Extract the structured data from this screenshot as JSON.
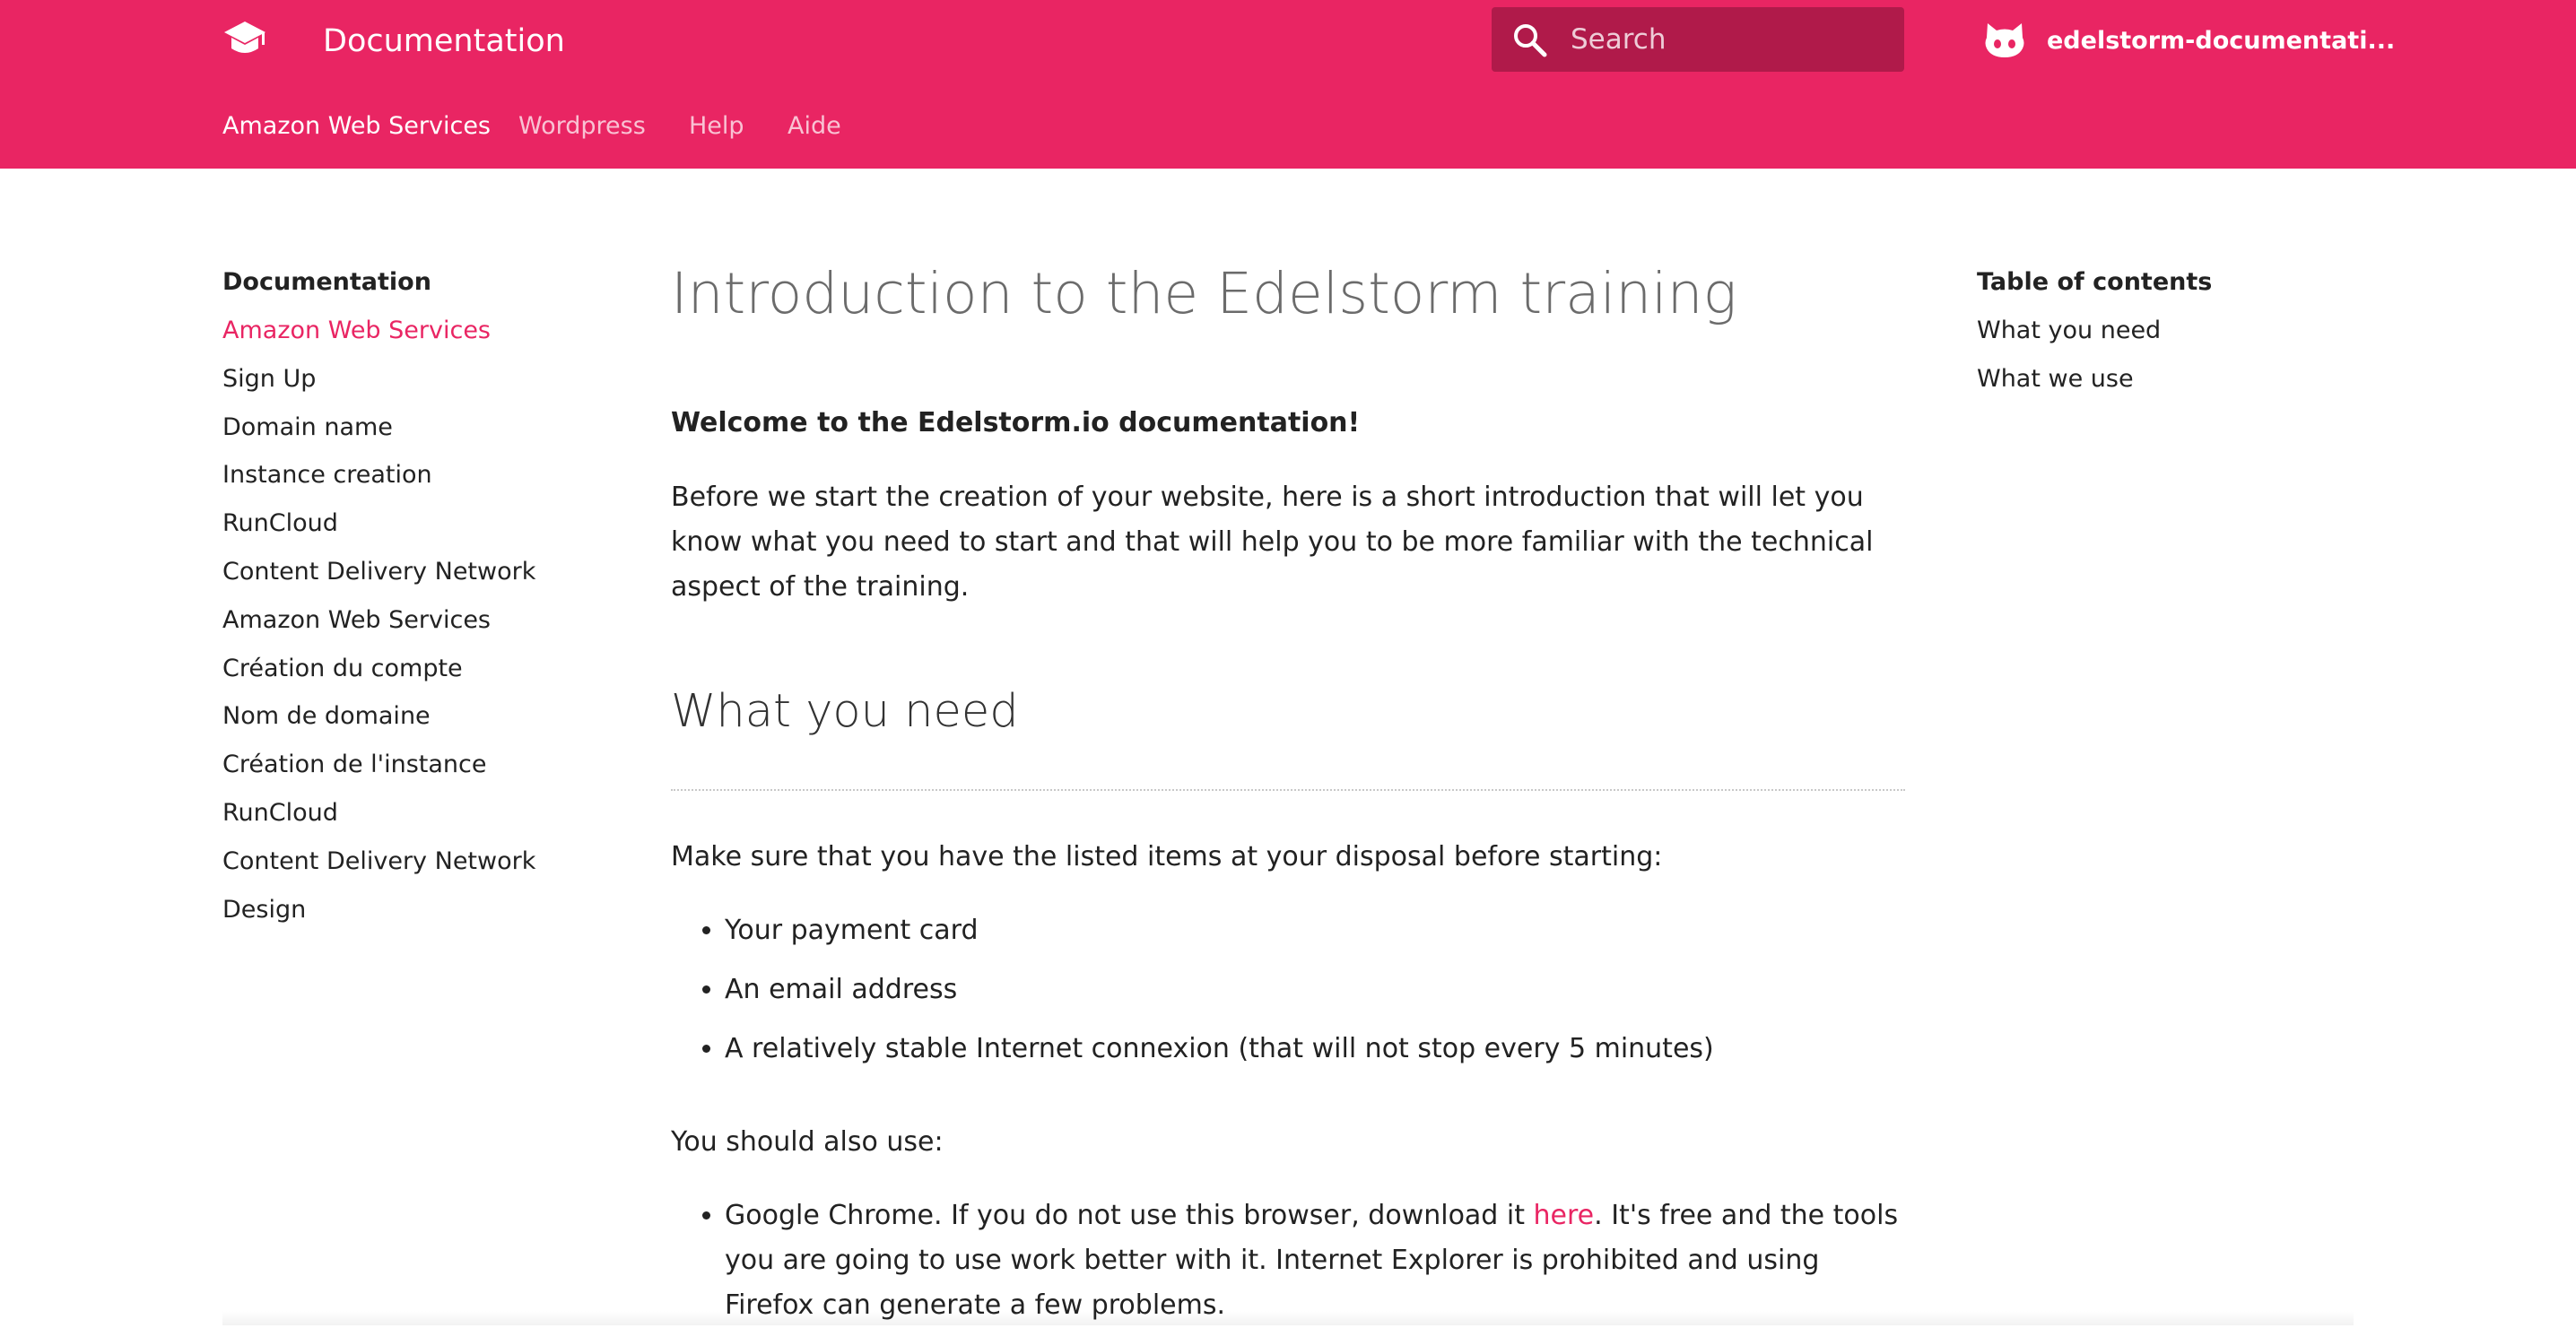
{
  "colors": {
    "brand": "#e92563",
    "search_bg": "#b01a4a",
    "text": "#222222",
    "title": "#6b6b6b"
  },
  "header": {
    "logo_icon": "graduation-cap-icon",
    "title": "Documentation",
    "search": {
      "placeholder": "Search",
      "icon": "magnifier-icon"
    },
    "repo": {
      "icon": "github-cat-icon",
      "name": "edelstorm-documentati..."
    },
    "tabs": [
      {
        "label": "Amazon Web Services",
        "active": true
      },
      {
        "label": "Wordpress",
        "active": false
      },
      {
        "label": "Help",
        "active": false
      },
      {
        "label": "Aide",
        "active": false
      }
    ]
  },
  "sidebar": {
    "title": "Documentation",
    "items": [
      {
        "label": "Amazon Web Services",
        "active": true
      },
      {
        "label": "Sign Up"
      },
      {
        "label": "Domain name"
      },
      {
        "label": "Instance creation"
      },
      {
        "label": "RunCloud"
      },
      {
        "label": "Content Delivery Network"
      },
      {
        "label": "Amazon Web Services"
      },
      {
        "label": "Création du compte"
      },
      {
        "label": "Nom de domaine"
      },
      {
        "label": "Création de l'instance"
      },
      {
        "label": "RunCloud"
      },
      {
        "label": "Content Delivery Network"
      },
      {
        "label": "Design"
      }
    ]
  },
  "main": {
    "title": "Introduction to the Edelstorm training",
    "welcome": "Welcome to the Edelstorm.io documentation!",
    "intro": "Before we start the creation of your website, here is a short introduction that will let you know what you need to start and that will help you to be more familiar with the technical aspect of the training.",
    "section_heading": "What you need",
    "need_intro": "Make sure that you have the listed items at your disposal before starting:",
    "needs": [
      "Your payment card",
      "An email address",
      "A relatively stable Internet connexion (that will not stop every 5 minutes)"
    ],
    "also_use": "You should also use:",
    "chrome": {
      "before": "Google Chrome. If you do not use this browser, download it ",
      "link": "here",
      "after": ". It's free and the tools you are going to use work better with it. Internet Explorer is prohibited and using Firefox can generate a few problems."
    }
  },
  "toc": {
    "title": "Table of contents",
    "items": [
      "What you need",
      "What we use"
    ]
  }
}
